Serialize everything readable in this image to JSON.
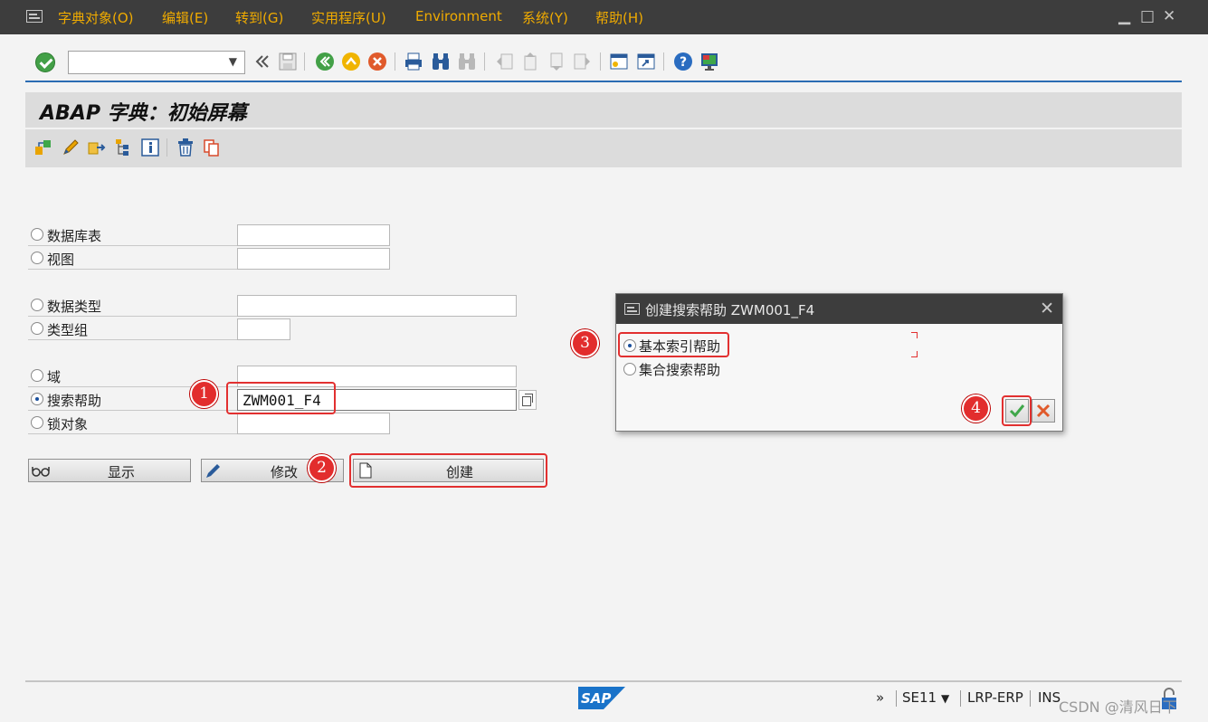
{
  "menubar": {
    "items": [
      "字典对象(O)",
      "编辑(E)",
      "转到(G)",
      "实用程序(U)",
      "Environment",
      "系统(Y)",
      "帮助(H)"
    ]
  },
  "toolbar": {
    "command_field_value": "",
    "icons": [
      "enter-icon",
      "back-arrows-icon",
      "save-icon",
      "back-icon",
      "exit-icon",
      "cancel-icon",
      "print-icon",
      "find-icon",
      "find-next-icon",
      "first-page-icon",
      "previous-page-icon",
      "next-page-icon",
      "last-page-icon",
      "new-session-icon",
      "shortcut-icon",
      "help-icon",
      "customize-layout-icon"
    ]
  },
  "title": "ABAP 字典：初始屏幕",
  "form": {
    "options": [
      {
        "label": "数据库表",
        "selected": false,
        "value": ""
      },
      {
        "label": "视图",
        "selected": false,
        "value": ""
      },
      {
        "label": "数据类型",
        "selected": false,
        "value": ""
      },
      {
        "label": "类型组",
        "selected": false,
        "value": ""
      },
      {
        "label": "域",
        "selected": false,
        "value": ""
      },
      {
        "label": "搜索帮助",
        "selected": true,
        "value": "ZWM001_F4"
      },
      {
        "label": "锁对象",
        "selected": false,
        "value": ""
      }
    ],
    "buttons": {
      "display": "显示",
      "change": "修改",
      "create": "创建"
    }
  },
  "dialog": {
    "title": "创建搜索帮助 ZWM001_F4",
    "options": [
      {
        "label": "基本索引帮助",
        "selected": true
      },
      {
        "label": "集合搜索帮助",
        "selected": false
      }
    ]
  },
  "annotations": [
    "1",
    "2",
    "3",
    "4"
  ],
  "status": {
    "transaction": "SE11",
    "system": "LRP-ERP",
    "mode": "INS",
    "watermark": "CSDN @清风日下"
  },
  "colors": {
    "menubar": "#3d3d3d",
    "menu_text": "#f0ab00",
    "accent": "#2b6cb3",
    "highlight": "#e23030"
  }
}
